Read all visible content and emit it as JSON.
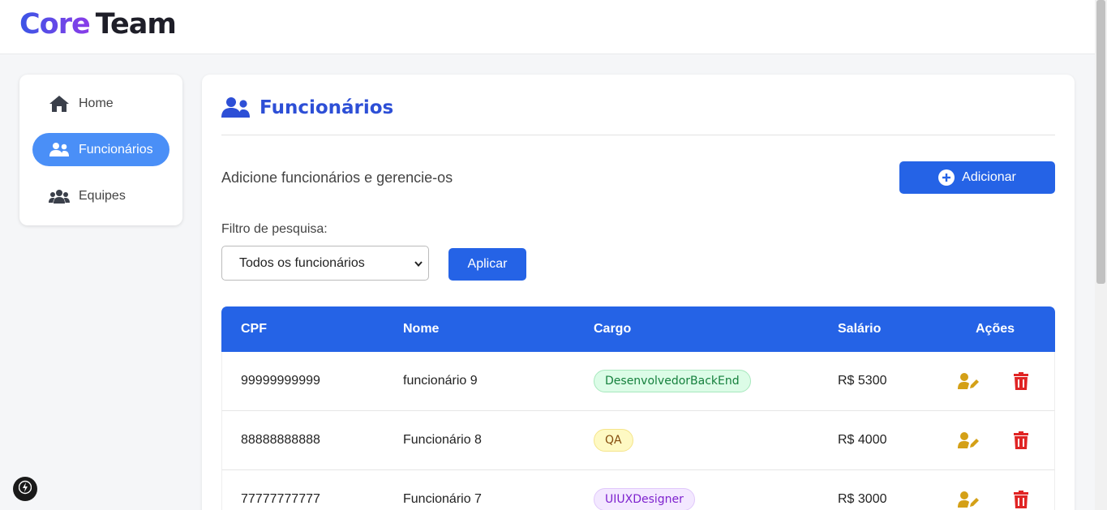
{
  "brand": {
    "word1": "Core",
    "word2": "Team"
  },
  "sidebar": {
    "items": [
      {
        "label": "Home",
        "icon": "home-icon",
        "active": false
      },
      {
        "label": "Funcionários",
        "icon": "users-icon",
        "active": true
      },
      {
        "label": "Equipes",
        "icon": "group-icon",
        "active": false
      }
    ]
  },
  "main": {
    "title": "Funcionários",
    "subtitle": "Adicione funcionários e gerencie-os",
    "add_label": "Adicionar",
    "filter": {
      "label": "Filtro de pesquisa:",
      "selected": "Todos os funcionários",
      "apply_label": "Aplicar"
    }
  },
  "table": {
    "headers": [
      "CPF",
      "Nome",
      "Cargo",
      "Salário",
      "Ações"
    ],
    "rows": [
      {
        "cpf": "99999999999",
        "nome": "funcionário 9",
        "cargo": "DesenvolvedorBackEnd",
        "salario": "R$ 5300"
      },
      {
        "cpf": "88888888888",
        "nome": "Funcionário 8",
        "cargo": "QA",
        "salario": "R$ 4000"
      },
      {
        "cpf": "77777777777",
        "nome": "Funcionário 7",
        "cargo": "UIUXDesigner",
        "salario": "R$ 3000"
      }
    ]
  },
  "colors": {
    "primary": "#2563e6",
    "sidebar_active": "#4a8ff7",
    "title": "#2d4fd6",
    "edit_icon": "#d4a017",
    "delete_icon": "#e02424",
    "badge_backend_bg": "#dcfce7",
    "badge_backend_text": "#15803d",
    "badge_qa_bg": "#fef9c3",
    "badge_qa_text": "#854d0e",
    "badge_ux_bg": "#f3e8ff",
    "badge_ux_text": "#7e22ce"
  }
}
